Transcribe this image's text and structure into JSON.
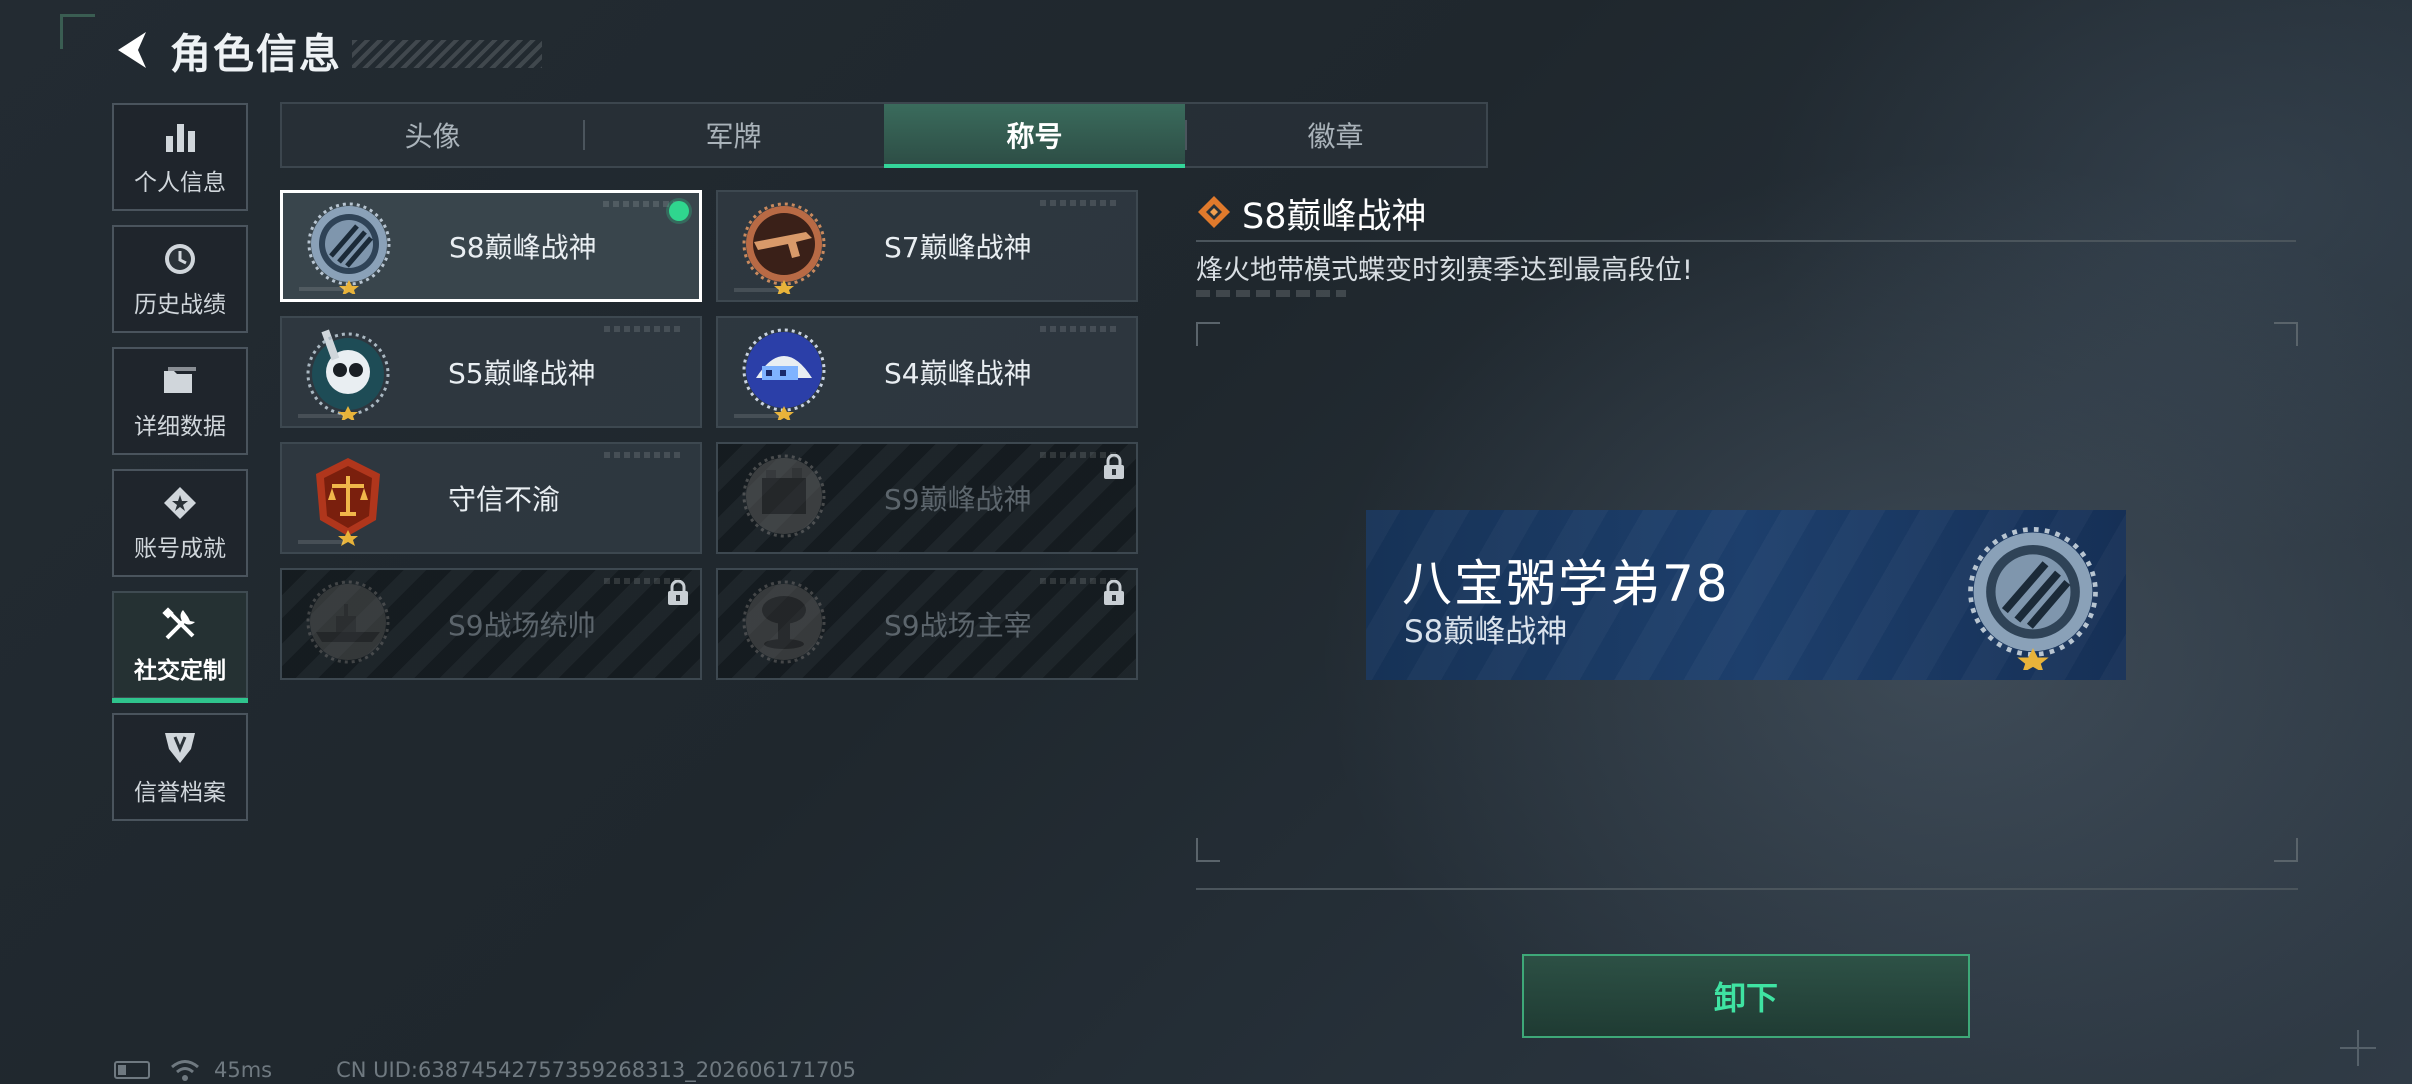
{
  "header": {
    "title": "角色信息",
    "back_icon": "chevron-left-icon"
  },
  "sidebar": {
    "items": [
      {
        "label": "个人信息",
        "icon": "bar-chart-icon",
        "active": false
      },
      {
        "label": "历史战绩",
        "icon": "history-clock-icon",
        "active": false
      },
      {
        "label": "详细数据",
        "icon": "folder-icon",
        "active": false
      },
      {
        "label": "账号成就",
        "icon": "achievement-icon",
        "active": false
      },
      {
        "label": "社交定制",
        "icon": "tools-icon",
        "active": true
      },
      {
        "label": "信誉档案",
        "icon": "shield-icon",
        "active": false
      }
    ]
  },
  "tabs": [
    {
      "label": "头像",
      "active": false
    },
    {
      "label": "军牌",
      "active": false
    },
    {
      "label": "称号",
      "active": true
    },
    {
      "label": "徽章",
      "active": false
    }
  ],
  "titles": [
    {
      "name": "S8巅峰战神",
      "badge": "s8-peak-badge-icon",
      "selected": true,
      "equipped": true,
      "locked": false
    },
    {
      "name": "S7巅峰战神",
      "badge": "s7-peak-badge-icon",
      "selected": false,
      "equipped": false,
      "locked": false
    },
    {
      "name": "S5巅峰战神",
      "badge": "s5-peak-badge-icon",
      "selected": false,
      "equipped": false,
      "locked": false
    },
    {
      "name": "S4巅峰战神",
      "badge": "s4-peak-badge-icon",
      "selected": false,
      "equipped": false,
      "locked": false
    },
    {
      "name": "守信不渝",
      "badge": "scales-badge-icon",
      "selected": false,
      "equipped": false,
      "locked": false
    },
    {
      "name": "S9巅峰战神",
      "badge": "s9-peak-badge-icon",
      "selected": false,
      "equipped": false,
      "locked": true
    },
    {
      "name": "S9战场统帅",
      "badge": "battleship-badge-icon",
      "selected": false,
      "equipped": false,
      "locked": true
    },
    {
      "name": "S9战场主宰",
      "badge": "mushroom-cloud-badge-icon",
      "selected": false,
      "equipped": false,
      "locked": true
    }
  ],
  "detail": {
    "title": "S8巅峰战神",
    "description": "烽火地带模式蝶变时刻赛季达到最高段位!",
    "title_icon": "diamond-icon"
  },
  "nameplate": {
    "player_name": "八宝粥学弟78",
    "title": "S8巅峰战神"
  },
  "actions": {
    "unequip_label": "卸下"
  },
  "status": {
    "ping": "45ms",
    "uid": "CN UID:63874542757359268313_202606171705"
  },
  "colors": {
    "accent": "#2fc48d",
    "button_text": "#3fe3a2",
    "nameplate_bg": "#1d3f6c"
  }
}
